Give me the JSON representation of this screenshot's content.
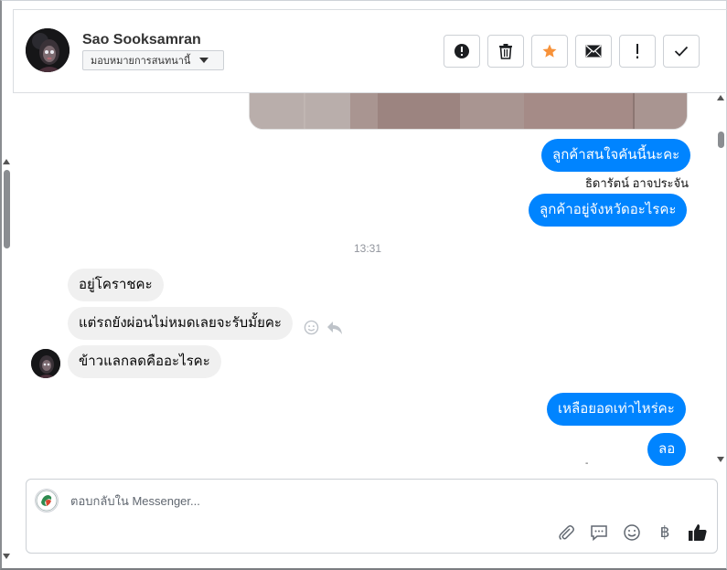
{
  "contact": {
    "name": "Sao Sooksamran",
    "assign_label": "มอบหมายการสนทนานี้"
  },
  "actions": [
    {
      "name": "spam-button",
      "icon": "alert-circle-icon"
    },
    {
      "name": "delete-button",
      "icon": "trash-icon"
    },
    {
      "name": "star-button",
      "icon": "star-icon",
      "color": "#f7923a"
    },
    {
      "name": "mark-unread-button",
      "icon": "envelope-icon"
    },
    {
      "name": "follow-up-button",
      "icon": "exclamation-icon"
    },
    {
      "name": "mark-done-button",
      "icon": "checkmark-icon"
    }
  ],
  "messages": {
    "out_1": "ลูกค้าสนใจคันนี้นะคะ",
    "sender_1": "ธิดารัตน์ อาจประจัน",
    "out_2": "ลูกค้าอยู่จังหวัดอะไรคะ",
    "time_1": "13:31",
    "in_1": "อยู่โคราชคะ",
    "in_2": "แต่รถยังผ่อนไม่หมดเลยจะรับมั้ยคะ",
    "in_3": "ข้าวแลกลดคืออะไรคะ",
    "out_3": "เหลือยอดเท่าไหร่คะ",
    "out_4": "ลอ",
    "trailing_mark": "-"
  },
  "composer": {
    "placeholder": "ตอบกลับใน Messenger..."
  },
  "colors": {
    "outgoing_bubble": "#0084ff",
    "incoming_bubble": "#f0f0f0",
    "star": "#f7923a"
  }
}
